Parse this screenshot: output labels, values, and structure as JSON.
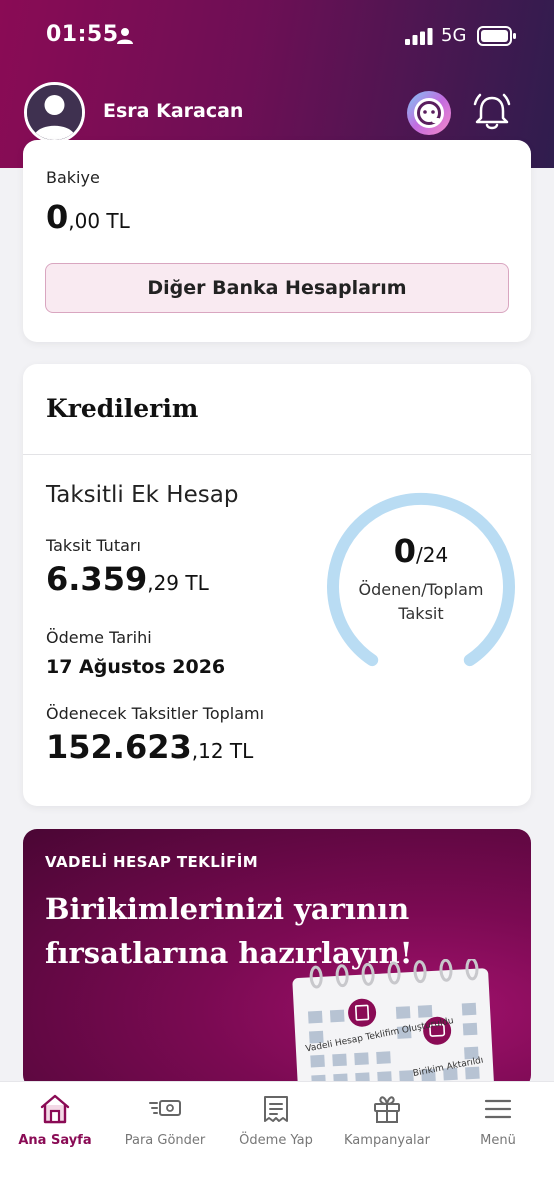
{
  "status_bar": {
    "time": "01:55",
    "network": "5G"
  },
  "header": {
    "user_name": "Esra Karacan"
  },
  "balance_card": {
    "label": "Bakiye",
    "amount_int": "0",
    "amount_dec": ",00 TL",
    "other_banks_label": "Diğer Banka Hesaplarım"
  },
  "loans": {
    "title": "Kredilerim",
    "loan_name": "Taksitli Ek Hesap",
    "installment_label": "Taksit Tutarı",
    "installment_int": "6.359",
    "installment_dec": ",29 TL",
    "payment_date_label": "Ödeme Tarihi",
    "payment_date": "17 Ağustos 2026",
    "remaining_label": "Ödenecek Taksitler Toplamı",
    "remaining_int": "152.623",
    "remaining_dec": ",12 TL",
    "progress": {
      "paid": "0",
      "total": "/24",
      "caption_line1": "Ödenen/Toplam",
      "caption_line2": "Taksit",
      "fraction_paid": 0
    }
  },
  "promo": {
    "tag": "VADELİ HESAP TEKLİFİM",
    "headline": "Birikimlerinizi yarının fırsatlarına hazırlayın!",
    "illustration_text_1": "Vadeli Hesap Teklifim Oluşturuldu",
    "illustration_text_2": "Birikim Aktarıldı"
  },
  "bottom_nav": {
    "items": [
      {
        "label": "Ana Sayfa",
        "icon": "home-icon",
        "active": true
      },
      {
        "label": "Para Gönder",
        "icon": "send-money-icon",
        "active": false
      },
      {
        "label": "Ödeme Yap",
        "icon": "receipt-icon",
        "active": false
      },
      {
        "label": "Kampanyalar",
        "icon": "gift-icon",
        "active": false
      },
      {
        "label": "Menü",
        "icon": "menu-icon",
        "active": false
      }
    ]
  },
  "colors": {
    "brand": "#8a0b55",
    "header_end": "#2f1d4e",
    "gauge": "#b9dcf3",
    "button_bg": "#f9eaf1"
  }
}
